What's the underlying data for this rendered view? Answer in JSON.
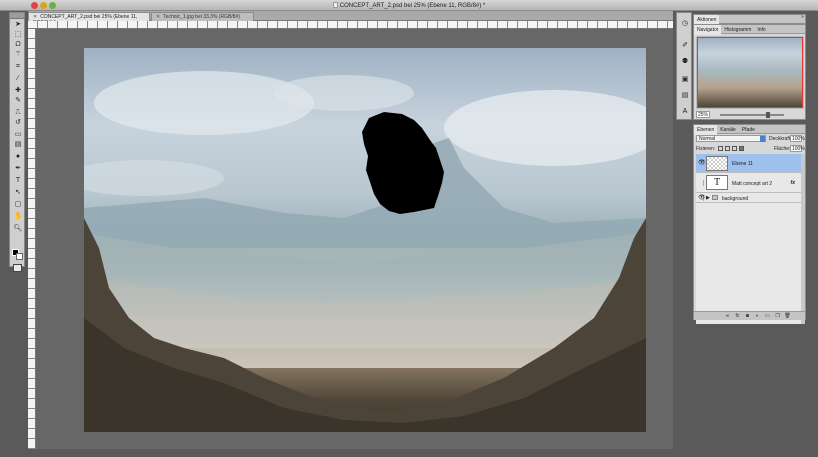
{
  "window": {
    "title": "CONCEPT_ART_2.psd bei 25% (Ebene 11, RGB/8#) *"
  },
  "tabs": [
    {
      "label": "CONCEPT_ART_2.psd bei 25% (Ebene 11, RGB/8#) *"
    },
    {
      "label": "Technic_1.jpg bei 33,3% (RGB/8#)"
    }
  ],
  "panels": {
    "actions": {
      "tab": "Aktionen"
    },
    "navigator": {
      "tabs": [
        "Navigator",
        "Histogramm",
        "Info"
      ],
      "zoom": "25%"
    },
    "layers": {
      "tabs": [
        "Ebenen",
        "Kanäle",
        "Pfade"
      ],
      "blend_mode": "Normal",
      "opacity_label": "Deckkraft:",
      "opacity_value": "100%",
      "lock_label": "Fixieren:",
      "fill_label": "Fläche:",
      "fill_value": "100%",
      "items": [
        {
          "name": "Ebene 11",
          "selected": true,
          "thumb": "transparent"
        },
        {
          "name": "Matt concept art 2",
          "selected": false,
          "thumb": "text",
          "thumb_glyph": "T",
          "fx": "fx"
        },
        {
          "name": "background",
          "selected": false,
          "thumb": "group"
        }
      ]
    }
  },
  "colors": {
    "foreground": "#000000",
    "background": "#ffffff",
    "selection": "#9ec0ee",
    "nav_view_box": "#ee3333"
  },
  "icons": {
    "toolbox": [
      "move-icon",
      "marquee-icon",
      "lasso-icon",
      "magic-wand-icon",
      "crop-icon",
      "eyedropper-icon",
      "healing-brush-icon",
      "brush-icon",
      "clone-stamp-icon",
      "history-brush-icon",
      "eraser-icon",
      "gradient-icon",
      "dodge-icon",
      "pen-icon",
      "type-icon",
      "path-select-icon",
      "shape-icon",
      "hand-icon",
      "zoom-icon"
    ],
    "layers_footer": [
      "link-icon",
      "fx-icon",
      "mask-icon",
      "adjustment-icon",
      "group-icon",
      "new-layer-icon",
      "trash-icon"
    ]
  }
}
